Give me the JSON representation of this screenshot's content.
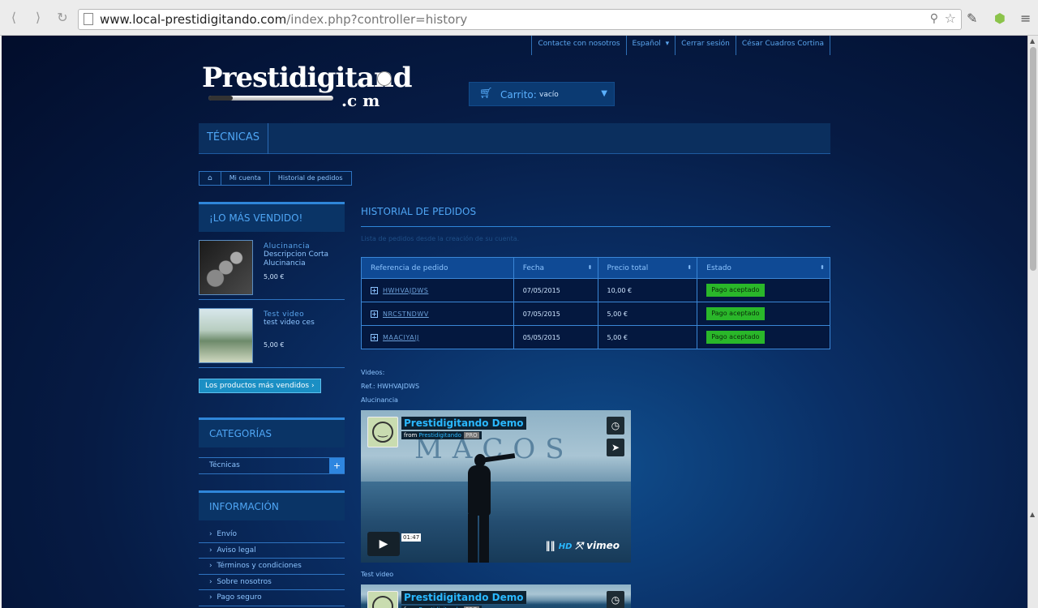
{
  "browser": {
    "url_host": "www.local-prestidigitando.com",
    "url_path": "/index.php?controller=history"
  },
  "toplinks": [
    "Contacte con nosotros",
    "Español",
    "Cerrar sesión",
    "César Cuadros Cortina"
  ],
  "logo": {
    "word": "Prestidigitand",
    "com": ".c m"
  },
  "cart": {
    "label": "Carrito:",
    "value": "vacío"
  },
  "menu": {
    "item": "TÉCNICAS"
  },
  "breadcrumb": [
    "Mi cuenta",
    "Historial de pedidos"
  ],
  "sidebar": {
    "bestsellers_title": "¡LO MÁS VENDIDO!",
    "products": [
      {
        "name": "Alucinancia",
        "desc": "Descripcion Corta Alucinancia",
        "price": "5,00 €"
      },
      {
        "name": "Test video",
        "desc": "test video ces",
        "price": "5,00 €"
      }
    ],
    "bestsellers_button": "Los productos más vendidos",
    "categories_title": "CATEGORÍAS",
    "category": "Técnicas",
    "info_title": "INFORMACIÓN",
    "info_items": [
      "Envío",
      "Aviso legal",
      "Términos y condiciones",
      "Sobre nosotros",
      "Pago seguro"
    ]
  },
  "content": {
    "title": "HISTORIAL DE PEDIDOS",
    "subtitle": "Lista de pedidos desde la creación de su cuenta.",
    "columns": [
      "Referencia de pedido",
      "Fecha",
      "Precio total",
      "Estado"
    ],
    "orders": [
      {
        "ref": "HWHVAJDWS",
        "date": "07/05/2015",
        "total": "10,00 €",
        "status": "Pago aceptado"
      },
      {
        "ref": "NRCSTNDWV",
        "date": "07/05/2015",
        "total": "5,00 €",
        "status": "Pago aceptado"
      },
      {
        "ref": "MAACIYAIJ",
        "date": "05/05/2015",
        "total": "5,00 €",
        "status": "Pago aceptado"
      }
    ],
    "videos_label": "Videos:",
    "ref_label": "Ref.: HWHVAJDWS",
    "video1_caption": "Alucinancia",
    "video2_caption": "Test video",
    "video": {
      "title": "Prestidigitando Demo",
      "from": "from",
      "from_link": "Prestidigitando",
      "pro": "PRO",
      "watermark": "MACOS",
      "time": "01:47",
      "hd": "HD",
      "brand": "vimeo"
    }
  },
  "colors": {
    "accent": "#4fa6f5",
    "status_ok": "#2ab72a",
    "background": "#061b44"
  }
}
